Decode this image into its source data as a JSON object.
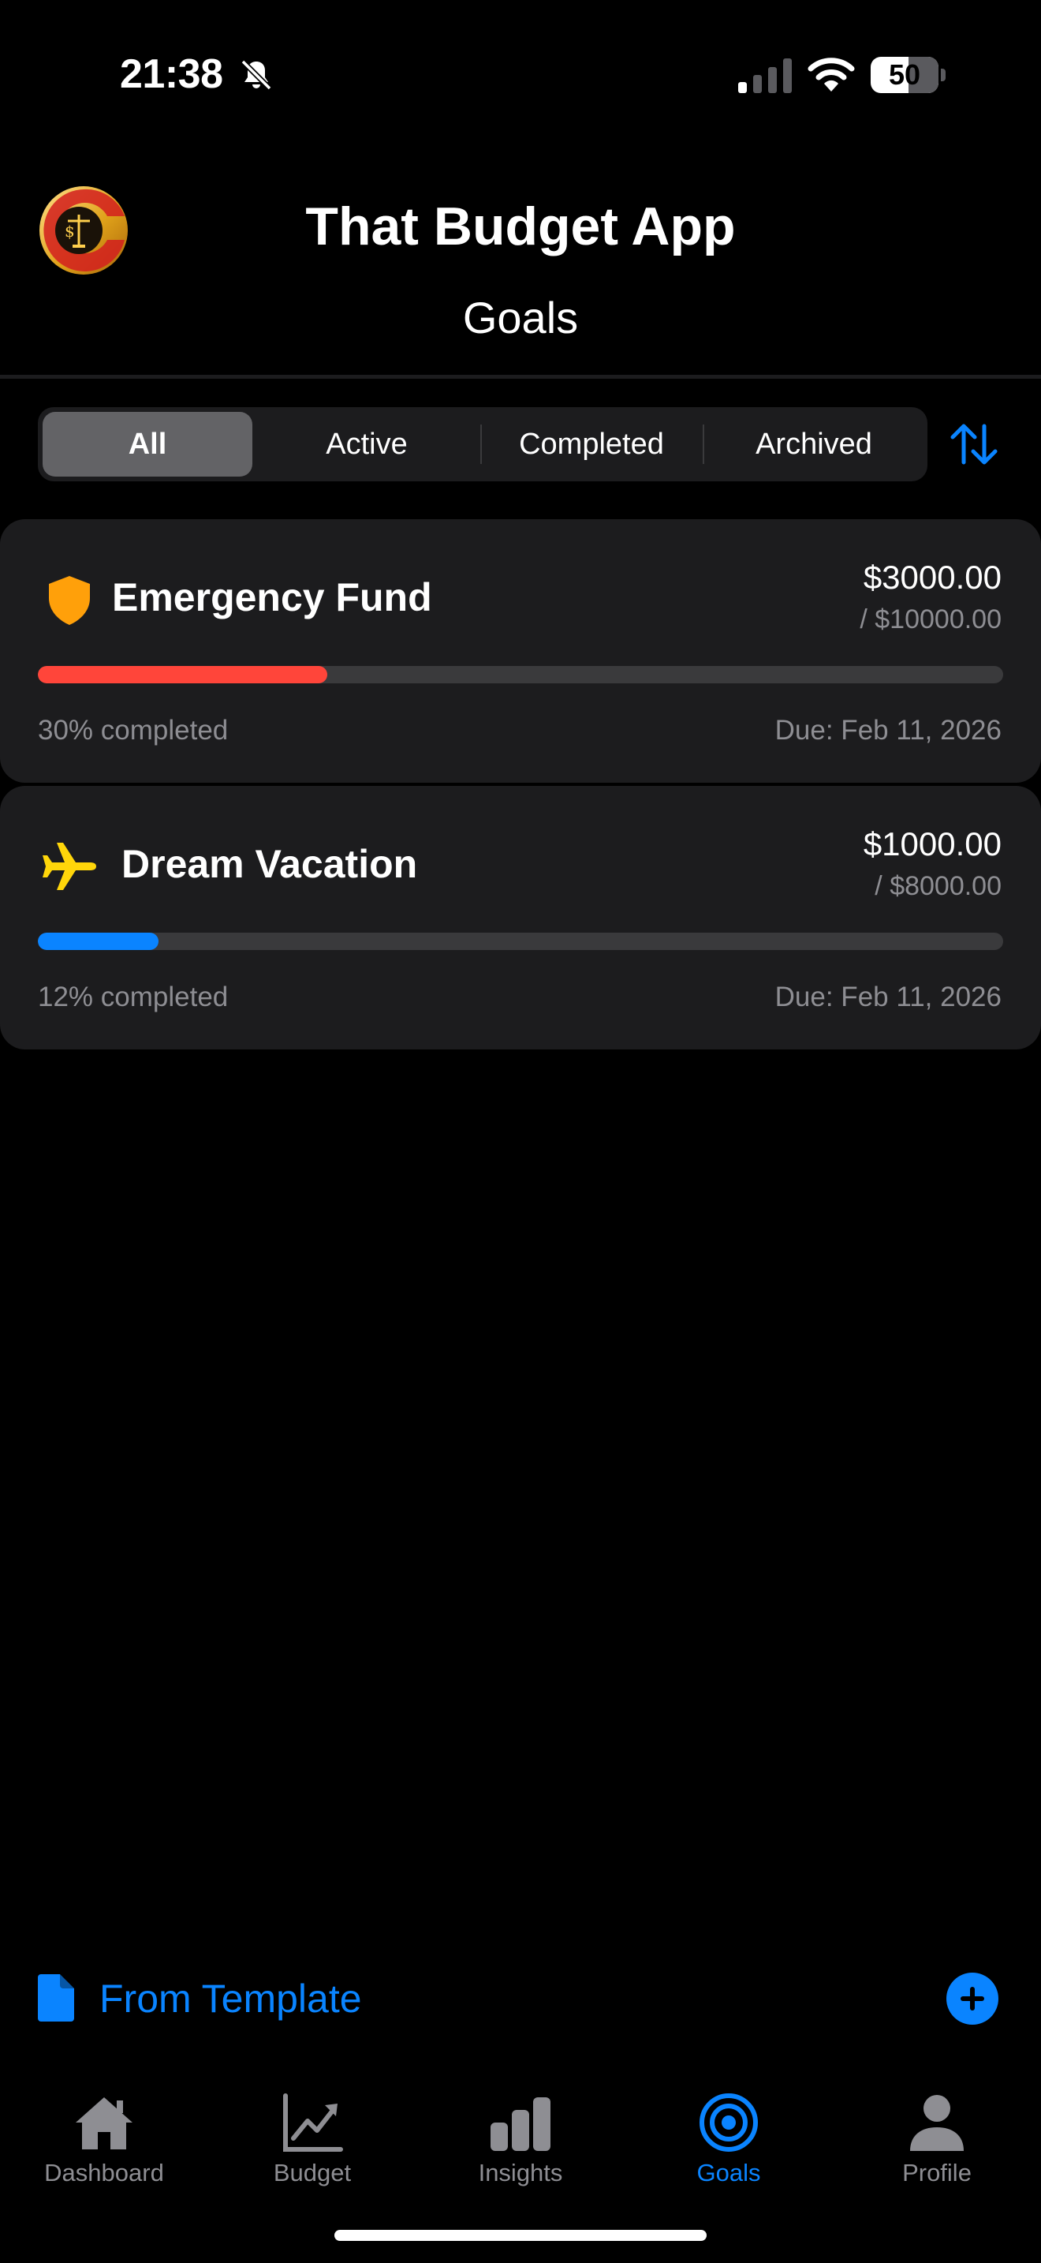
{
  "status_bar": {
    "time": "21:38",
    "battery": "50"
  },
  "header": {
    "app_title": "That Budget App",
    "page_title": "Goals"
  },
  "filters": {
    "tabs": [
      "All",
      "Active",
      "Completed",
      "Archived"
    ],
    "selected": "All"
  },
  "goals": [
    {
      "name": "Emergency Fund",
      "icon": "shield-icon",
      "current": "$3000.00",
      "target": "/ $10000.00",
      "percent_text": "30% completed",
      "progress": 0.3,
      "due": "Due: Feb 11, 2026",
      "color": "#ff453a",
      "icon_color": "#ffa00a"
    },
    {
      "name": "Dream Vacation",
      "icon": "airplane-icon",
      "current": "$1000.00",
      "target": "/ $8000.00",
      "percent_text": "12% completed",
      "progress": 0.125,
      "due": "Due: Feb 11, 2026",
      "color": "#0a84ff",
      "icon_color": "#ffd60a"
    }
  ],
  "template_bar": {
    "label": "From Template"
  },
  "tabbar": {
    "items": [
      {
        "label": "Dashboard",
        "icon": "house-icon"
      },
      {
        "label": "Budget",
        "icon": "chart-line-icon"
      },
      {
        "label": "Insights",
        "icon": "bar-chart-icon"
      },
      {
        "label": "Goals",
        "icon": "target-icon"
      },
      {
        "label": "Profile",
        "icon": "person-icon"
      }
    ],
    "active": "Goals"
  },
  "colors": {
    "accent": "#0a84ff",
    "background": "#000000",
    "card": "#1c1c1e",
    "secondary_text": "#8e8e93"
  }
}
